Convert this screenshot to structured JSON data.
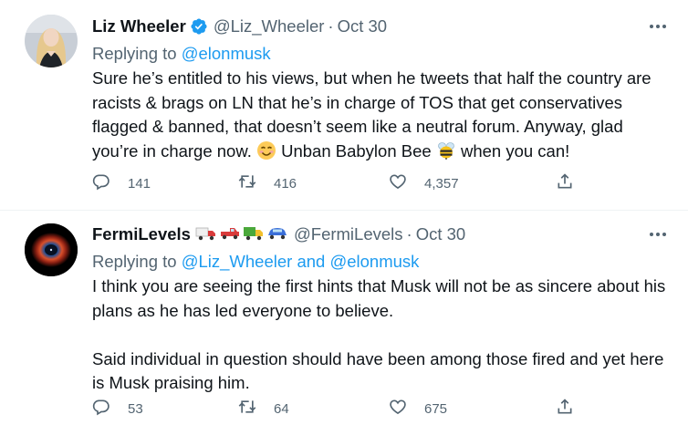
{
  "tweets": [
    {
      "name": "Liz Wheeler",
      "handle": "@Liz_Wheeler",
      "time": "Oct 30",
      "verified": true,
      "replying_prefix": "Replying to ",
      "replying_to": "@elonmusk",
      "text_1": "Sure he’s entitled to his views, but when he tweets that half the country are racists & brags on LN that he’s in charge of TOS that get conservatives flagged & banned, that doesn’t seem like a neutral forum. Anyway, glad you’re in charge now. ",
      "text_2": " Unban Babylon Bee ",
      "text_3": " when you can!",
      "reply_count": "141",
      "retweet_count": "416",
      "like_count": "4,357"
    },
    {
      "name": "FermiLevels",
      "handle": "@FermiLevels",
      "time": "Oct 30",
      "verified": false,
      "replying_prefix": "Replying to ",
      "replying_to": "@Liz_Wheeler and @elonmusk",
      "paragraph_1": "I think you are seeing the first hints that Musk will not be as sincere about his plans as he has led everyone to believe.",
      "paragraph_2": "Said individual in question should have been among those fired and yet here is Musk praising him.",
      "reply_count": "53",
      "retweet_count": "64",
      "like_count": "675"
    }
  ],
  "separator": "·",
  "colors": {
    "text": "#0f1419",
    "secondary": "#536471",
    "link": "#1d9bf0",
    "verified": "#1d9bf0",
    "border": "#eff3f4"
  },
  "icons": [
    "verified-badge-icon",
    "more-icon",
    "reply-icon",
    "retweet-icon",
    "like-icon",
    "share-icon",
    "smiling-face-emoji",
    "bee-emoji",
    "truck-emoji",
    "car-emoji"
  ]
}
